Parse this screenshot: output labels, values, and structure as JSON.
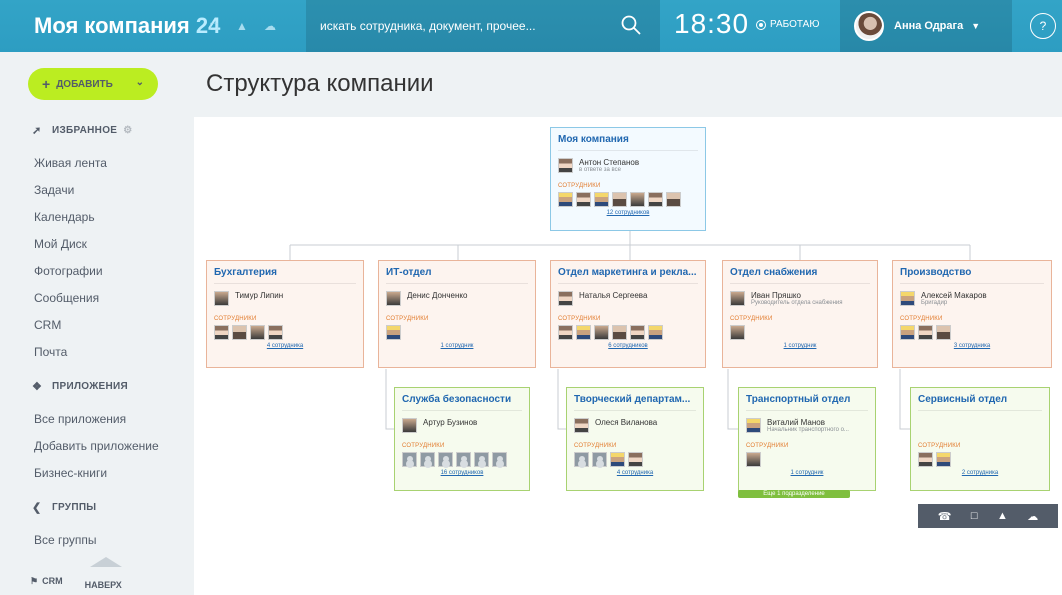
{
  "header": {
    "brand": "Моя компания",
    "brand_num": "24",
    "search_placeholder": "искать сотрудника, документ, прочее...",
    "clock": "18:30",
    "status": "РАБОТАЮ",
    "user": "Анна Одрага",
    "help": "?"
  },
  "left": {
    "add_label": "ДОБАВИТЬ",
    "favorites": "ИЗБРАННОЕ",
    "fav_items": [
      "Живая лента",
      "Задачи",
      "Календарь",
      "Мой Диск",
      "Фотографии",
      "Сообщения",
      "CRM",
      "Почта"
    ],
    "apps": "ПРИЛОЖЕНИЯ",
    "app_items": [
      "Все приложения",
      "Добавить приложение",
      "Бизнес-книги"
    ],
    "groups": "ГРУППЫ",
    "group_items": [
      "Все группы"
    ],
    "crm": "CRM",
    "to_top": "НАВЕРХ"
  },
  "page": {
    "title": "Структура компании"
  },
  "org": {
    "root": {
      "title": "Моя компания",
      "head": "Антон Степанов",
      "position": "в ответе за все",
      "emp_label": "СОТРУДНИКИ",
      "count": "12 сотрудников"
    },
    "depts": [
      {
        "title": "Бухгалтерия",
        "head": "Тимур Липин",
        "position": "",
        "emp_label": "СОТРУДНИКИ",
        "count": "4 сотрудника"
      },
      {
        "title": "ИТ-отдел",
        "head": "Денис Донченко",
        "position": "",
        "emp_label": "СОТРУДНИКИ",
        "count": "1 сотрудник"
      },
      {
        "title": "Отдел маркетинга и рекла...",
        "head": "Наталья Сергеева",
        "position": "",
        "emp_label": "СОТРУДНИКИ",
        "count": "6 сотрудников"
      },
      {
        "title": "Отдел снабжения",
        "head": "Иван Пряшко",
        "position": "Руководитель отдела снабжения",
        "emp_label": "СОТРУДНИКИ",
        "count": "1 сотрудник"
      },
      {
        "title": "Производство",
        "head": "Алексей Макаров",
        "position": "Бригадир",
        "emp_label": "СОТРУДНИКИ",
        "count": "3 сотрудника"
      }
    ],
    "subs": [
      {
        "title": "Служба безопасности",
        "head": "Артур Бузинов",
        "position": "",
        "emp_label": "СОТРУДНИКИ",
        "count": "16 сотрудников"
      },
      {
        "title": "Творческий департам...",
        "head": "Олеся Виланова",
        "position": "",
        "emp_label": "СОТРУДНИКИ",
        "count": "4 сотрудника"
      },
      {
        "title": "Транспортный отдел",
        "head": "Виталий Манов",
        "position": "Начальник транспортного о...",
        "emp_label": "СОТРУДНИКИ",
        "count": "1 сотрудник"
      },
      {
        "title": "Сервисный отдел",
        "head": "",
        "position": "",
        "emp_label": "СОТРУДНИКИ",
        "count": "2 сотрудника"
      }
    ],
    "more_subdivision": "Еще 1 подразделение"
  },
  "colors": {
    "topbar": "#2d9dc2",
    "add_button": "#bbed21",
    "link": "#2067b0",
    "dept_border": "#e9b49a",
    "sub_border": "#a8d271"
  }
}
